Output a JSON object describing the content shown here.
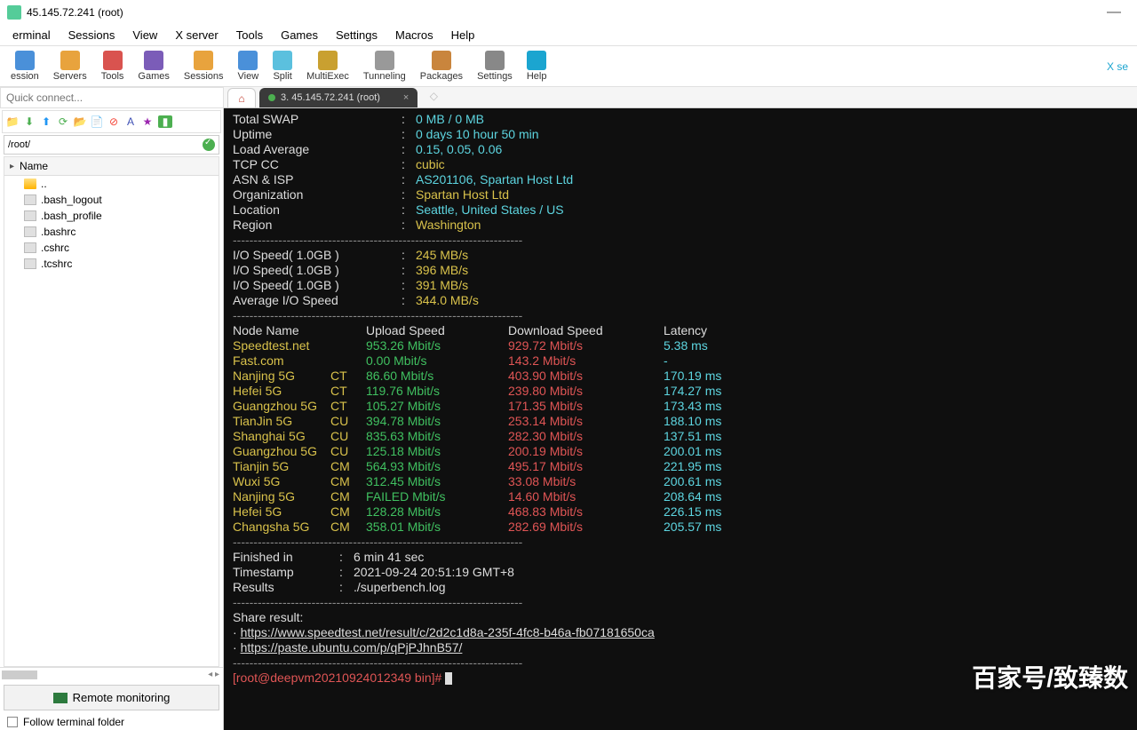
{
  "window": {
    "title": "45.145.72.241 (root)",
    "minimize": "—"
  },
  "menu": [
    "erminal",
    "Sessions",
    "View",
    "X server",
    "Tools",
    "Games",
    "Settings",
    "Macros",
    "Help"
  ],
  "tools": [
    {
      "label": "ession",
      "color": "#4a90d9"
    },
    {
      "label": "Servers",
      "color": "#e8a33d"
    },
    {
      "label": "Tools",
      "color": "#d9534f"
    },
    {
      "label": "Games",
      "color": "#7b5cb8"
    },
    {
      "label": "Sessions",
      "color": "#e8a33d"
    },
    {
      "label": "View",
      "color": "#4a90d9"
    },
    {
      "label": "Split",
      "color": "#5bc0de"
    },
    {
      "label": "MultiExec",
      "color": "#c9a030"
    },
    {
      "label": "Tunneling",
      "color": "#999"
    },
    {
      "label": "Packages",
      "color": "#c9853d"
    },
    {
      "label": "Settings",
      "color": "#888"
    },
    {
      "label": "Help",
      "color": "#1ba5d0"
    }
  ],
  "right_label": "X se",
  "quick_placeholder": "Quick connect...",
  "sidebar": {
    "path": "/root/",
    "header": "Name",
    "items": [
      "..",
      ".bash_logout",
      ".bash_profile",
      ".bashrc",
      ".cshrc",
      ".tcshrc"
    ],
    "remote_btn": "Remote monitoring",
    "follow": "Follow terminal folder"
  },
  "tab": {
    "label": "3. 45.145.72.241 (root)",
    "close": "×"
  },
  "term": {
    "kv": [
      {
        "k": "Total SWAP",
        "v": "0 MB / 0 MB",
        "cls": "cyan"
      },
      {
        "k": "Uptime",
        "v": "0 days 10 hour 50 min",
        "cls": "cyan"
      },
      {
        "k": "Load Average",
        "v": "0.15, 0.05, 0.06",
        "cls": "cyan"
      },
      {
        "k": "TCP CC",
        "v": "cubic",
        "cls": "yellow"
      },
      {
        "k": "ASN & ISP",
        "v": "AS201106, Spartan Host Ltd",
        "cls": "cyan"
      },
      {
        "k": "Organization",
        "v": "Spartan Host Ltd",
        "cls": "yellow"
      },
      {
        "k": "Location",
        "v": "Seattle, United States / US",
        "cls": "cyan"
      },
      {
        "k": "Region",
        "v": "Washington",
        "cls": "yellow"
      }
    ],
    "io": [
      {
        "k": "I/O Speed( 1.0GB )",
        "v": "245 MB/s"
      },
      {
        "k": "I/O Speed( 1.0GB )",
        "v": "396 MB/s"
      },
      {
        "k": "I/O Speed( 1.0GB )",
        "v": "391 MB/s"
      },
      {
        "k": "Average I/O Speed",
        "v": "344.0 MB/s"
      }
    ],
    "st_header": {
      "name": "Node Name",
      "up": "Upload Speed",
      "dn": "Download Speed",
      "lat": "Latency"
    },
    "st": [
      {
        "name": "Speedtest.net",
        "isp": "",
        "up": "953.26 Mbit/s",
        "dn": "929.72 Mbit/s",
        "lat": "5.38 ms",
        "ncls": "yellow"
      },
      {
        "name": "Fast.com",
        "isp": "",
        "up": "0.00 Mbit/s",
        "dn": "143.2 Mbit/s",
        "lat": "-",
        "ncls": "yellow"
      },
      {
        "name": "Nanjing 5G",
        "isp": "CT",
        "up": "86.60 Mbit/s",
        "dn": "403.90 Mbit/s",
        "lat": "170.19 ms",
        "ncls": "yellow"
      },
      {
        "name": "Hefei 5G",
        "isp": "CT",
        "up": "119.76 Mbit/s",
        "dn": "239.80 Mbit/s",
        "lat": "174.27 ms",
        "ncls": "yellow"
      },
      {
        "name": "Guangzhou 5G",
        "isp": "CT",
        "up": "105.27 Mbit/s",
        "dn": "171.35 Mbit/s",
        "lat": "173.43 ms",
        "ncls": "yellow"
      },
      {
        "name": "TianJin 5G",
        "isp": "CU",
        "up": "394.78 Mbit/s",
        "dn": "253.14 Mbit/s",
        "lat": "188.10 ms",
        "ncls": "yellow"
      },
      {
        "name": "Shanghai 5G",
        "isp": "CU",
        "up": "835.63 Mbit/s",
        "dn": "282.30 Mbit/s",
        "lat": "137.51 ms",
        "ncls": "yellow"
      },
      {
        "name": "Guangzhou 5G",
        "isp": "CU",
        "up": "125.18 Mbit/s",
        "dn": "200.19 Mbit/s",
        "lat": "200.01 ms",
        "ncls": "yellow"
      },
      {
        "name": "Tianjin 5G",
        "isp": "CM",
        "up": "564.93 Mbit/s",
        "dn": "495.17 Mbit/s",
        "lat": "221.95 ms",
        "ncls": "yellow"
      },
      {
        "name": "Wuxi 5G",
        "isp": "CM",
        "up": "312.45 Mbit/s",
        "dn": "33.08 Mbit/s",
        "lat": "200.61 ms",
        "ncls": "yellow"
      },
      {
        "name": "Nanjing 5G",
        "isp": "CM",
        "up": "FAILED Mbit/s",
        "dn": "14.60 Mbit/s",
        "lat": "208.64 ms",
        "ncls": "yellow"
      },
      {
        "name": "Hefei 5G",
        "isp": "CM",
        "up": "128.28 Mbit/s",
        "dn": "468.83 Mbit/s",
        "lat": "226.15 ms",
        "ncls": "yellow"
      },
      {
        "name": "Changsha 5G",
        "isp": "CM",
        "up": "358.01 Mbit/s",
        "dn": "282.69 Mbit/s",
        "lat": "205.57 ms",
        "ncls": "yellow"
      }
    ],
    "finished_k": "Finished in",
    "finished_v": "6 min 41 sec",
    "timestamp_k": "Timestamp",
    "timestamp_v": "2021-09-24 20:51:19 GMT+8",
    "results_k": "Results",
    "results_v": "./superbench.log",
    "share": "Share result:",
    "link1": "https://www.speedtest.net/result/c/2d2c1d8a-235f-4fc8-b46a-fb07181650ca",
    "link2": "https://paste.ubuntu.com/p/qPjPJhnB57/",
    "prompt": "[root@deepvm20210924012349 bin]# "
  },
  "dashes": "----------------------------------------------------------------------",
  "watermark": "百家号/致臻数"
}
